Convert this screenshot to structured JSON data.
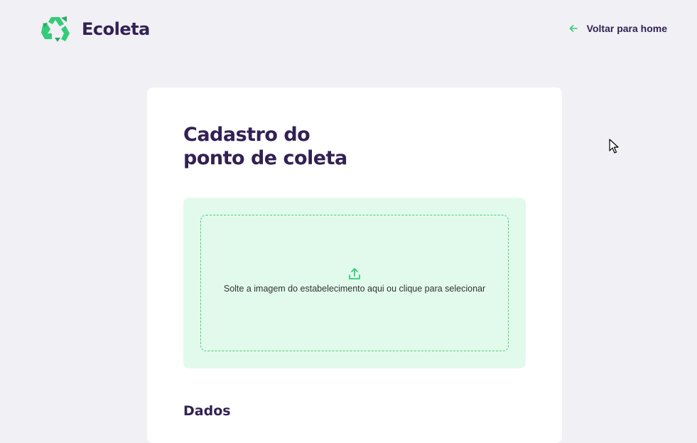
{
  "header": {
    "brand": "Ecoleta",
    "logo_icon": "recycle-icon",
    "back_link_label": "Voltar para home",
    "back_icon": "arrow-left-icon"
  },
  "form": {
    "title_line1": "Cadastro do",
    "title_line2": "ponto de coleta",
    "dropzone": {
      "icon": "upload-icon",
      "text": "Solte a imagem do estabelecimento aqui ou clique para selecionar"
    },
    "section_dados": "Dados"
  },
  "colors": {
    "background": "#F0F0F5",
    "title": "#322153",
    "primary_green": "#34CB79",
    "dropzone_bg": "#E1FAEC",
    "card": "#FFFFFF"
  }
}
